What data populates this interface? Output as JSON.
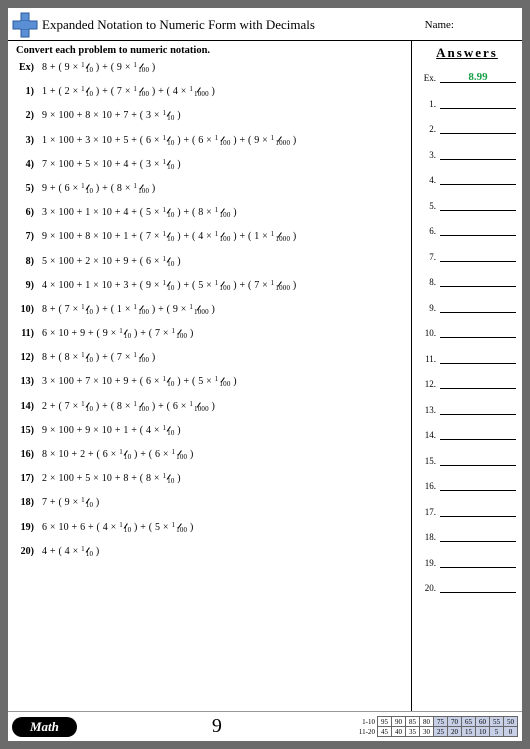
{
  "header": {
    "title": "Expanded Notation to Numeric Form with Decimals",
    "name_label": "Name:"
  },
  "instruction": "Convert each problem to numeric notation.",
  "problems": [
    {
      "num": "Ex)",
      "expr": "8 + ( 9 × {1/10} ) + ( 9 × {1/100} )"
    },
    {
      "num": "1)",
      "expr": "1 + ( 2 × {1/10} ) + ( 7 × {1/100} ) + ( 4 × {1/1000} )"
    },
    {
      "num": "2)",
      "expr": "9 × 100 + 8 × 10 + 7 + ( 3 × {1/10} )"
    },
    {
      "num": "3)",
      "expr": "1 × 100 + 3 × 10 + 5 + ( 6 × {1/10} ) + ( 6 × {1/100} ) + ( 9 × {1/1000} )"
    },
    {
      "num": "4)",
      "expr": "7 × 100 + 5 × 10 + 4 + ( 3 × {1/10} )"
    },
    {
      "num": "5)",
      "expr": "9 + ( 6 × {1/10} ) + ( 8 × {1/100} )"
    },
    {
      "num": "6)",
      "expr": "3 × 100 + 1 × 10 + 4 + ( 5 × {1/10} ) + ( 8 × {1/100} )"
    },
    {
      "num": "7)",
      "expr": "9 × 100 + 8 × 10 + 1 + ( 7 × {1/10} ) + ( 4 × {1/100} ) + ( 1 × {1/1000} )"
    },
    {
      "num": "8)",
      "expr": "5 × 100 + 2 × 10 + 9 + ( 6 × {1/10} )"
    },
    {
      "num": "9)",
      "expr": "4 × 100 + 1 × 10 + 3 + ( 9 × {1/10} ) + ( 5 × {1/100} ) + ( 7 × {1/1000} )"
    },
    {
      "num": "10)",
      "expr": "8 + ( 7 × {1/10} ) + ( 1 × {1/100} ) + ( 9 × {1/1000} )"
    },
    {
      "num": "11)",
      "expr": "6 × 10 + 9 + ( 9 × {1/10} ) + ( 7 × {1/100} )"
    },
    {
      "num": "12)",
      "expr": "8 + ( 8 × {1/10} ) + ( 7 × {1/100} )"
    },
    {
      "num": "13)",
      "expr": "3 × 100 + 7 × 10 + 9 + ( 6 × {1/10} ) + ( 5 × {1/100} )"
    },
    {
      "num": "14)",
      "expr": "2 + ( 7 × {1/10} ) + ( 8 × {1/100} ) + ( 6 × {1/1000} )"
    },
    {
      "num": "15)",
      "expr": "9 × 100 + 9 × 10 + 1 + ( 4 × {1/10} )"
    },
    {
      "num": "16)",
      "expr": "8 × 10 + 2 + ( 6 × {1/10} ) + ( 6 × {1/100} )"
    },
    {
      "num": "17)",
      "expr": "2 × 100 + 5 × 10 + 8 + ( 8 × {1/10} )"
    },
    {
      "num": "18)",
      "expr": "7 + ( 9 × {1/10} )"
    },
    {
      "num": "19)",
      "expr": "6 × 10 + 6 + ( 4 × {1/10} ) + ( 5 × {1/100} )"
    },
    {
      "num": "20)",
      "expr": "4 + ( 4 × {1/10} )"
    }
  ],
  "answers": {
    "title": "Answers",
    "rows": [
      {
        "label": "Ex.",
        "value": "8.99"
      },
      {
        "label": "1.",
        "value": ""
      },
      {
        "label": "2.",
        "value": ""
      },
      {
        "label": "3.",
        "value": ""
      },
      {
        "label": "4.",
        "value": ""
      },
      {
        "label": "5.",
        "value": ""
      },
      {
        "label": "6.",
        "value": ""
      },
      {
        "label": "7.",
        "value": ""
      },
      {
        "label": "8.",
        "value": ""
      },
      {
        "label": "9.",
        "value": ""
      },
      {
        "label": "10.",
        "value": ""
      },
      {
        "label": "11.",
        "value": ""
      },
      {
        "label": "12.",
        "value": ""
      },
      {
        "label": "13.",
        "value": ""
      },
      {
        "label": "14.",
        "value": ""
      },
      {
        "label": "15.",
        "value": ""
      },
      {
        "label": "16.",
        "value": ""
      },
      {
        "label": "17.",
        "value": ""
      },
      {
        "label": "18.",
        "value": ""
      },
      {
        "label": "19.",
        "value": ""
      },
      {
        "label": "20.",
        "value": ""
      }
    ]
  },
  "footer": {
    "brand": "Math",
    "page": "9",
    "score": {
      "row_labels": [
        "1-10",
        "11-20"
      ],
      "rows": [
        [
          "95",
          "90",
          "85",
          "80",
          "75",
          "70",
          "65",
          "60",
          "55",
          "50"
        ],
        [
          "45",
          "40",
          "35",
          "30",
          "25",
          "20",
          "15",
          "10",
          "5",
          "0"
        ]
      ],
      "shade_from_col": 4
    }
  }
}
